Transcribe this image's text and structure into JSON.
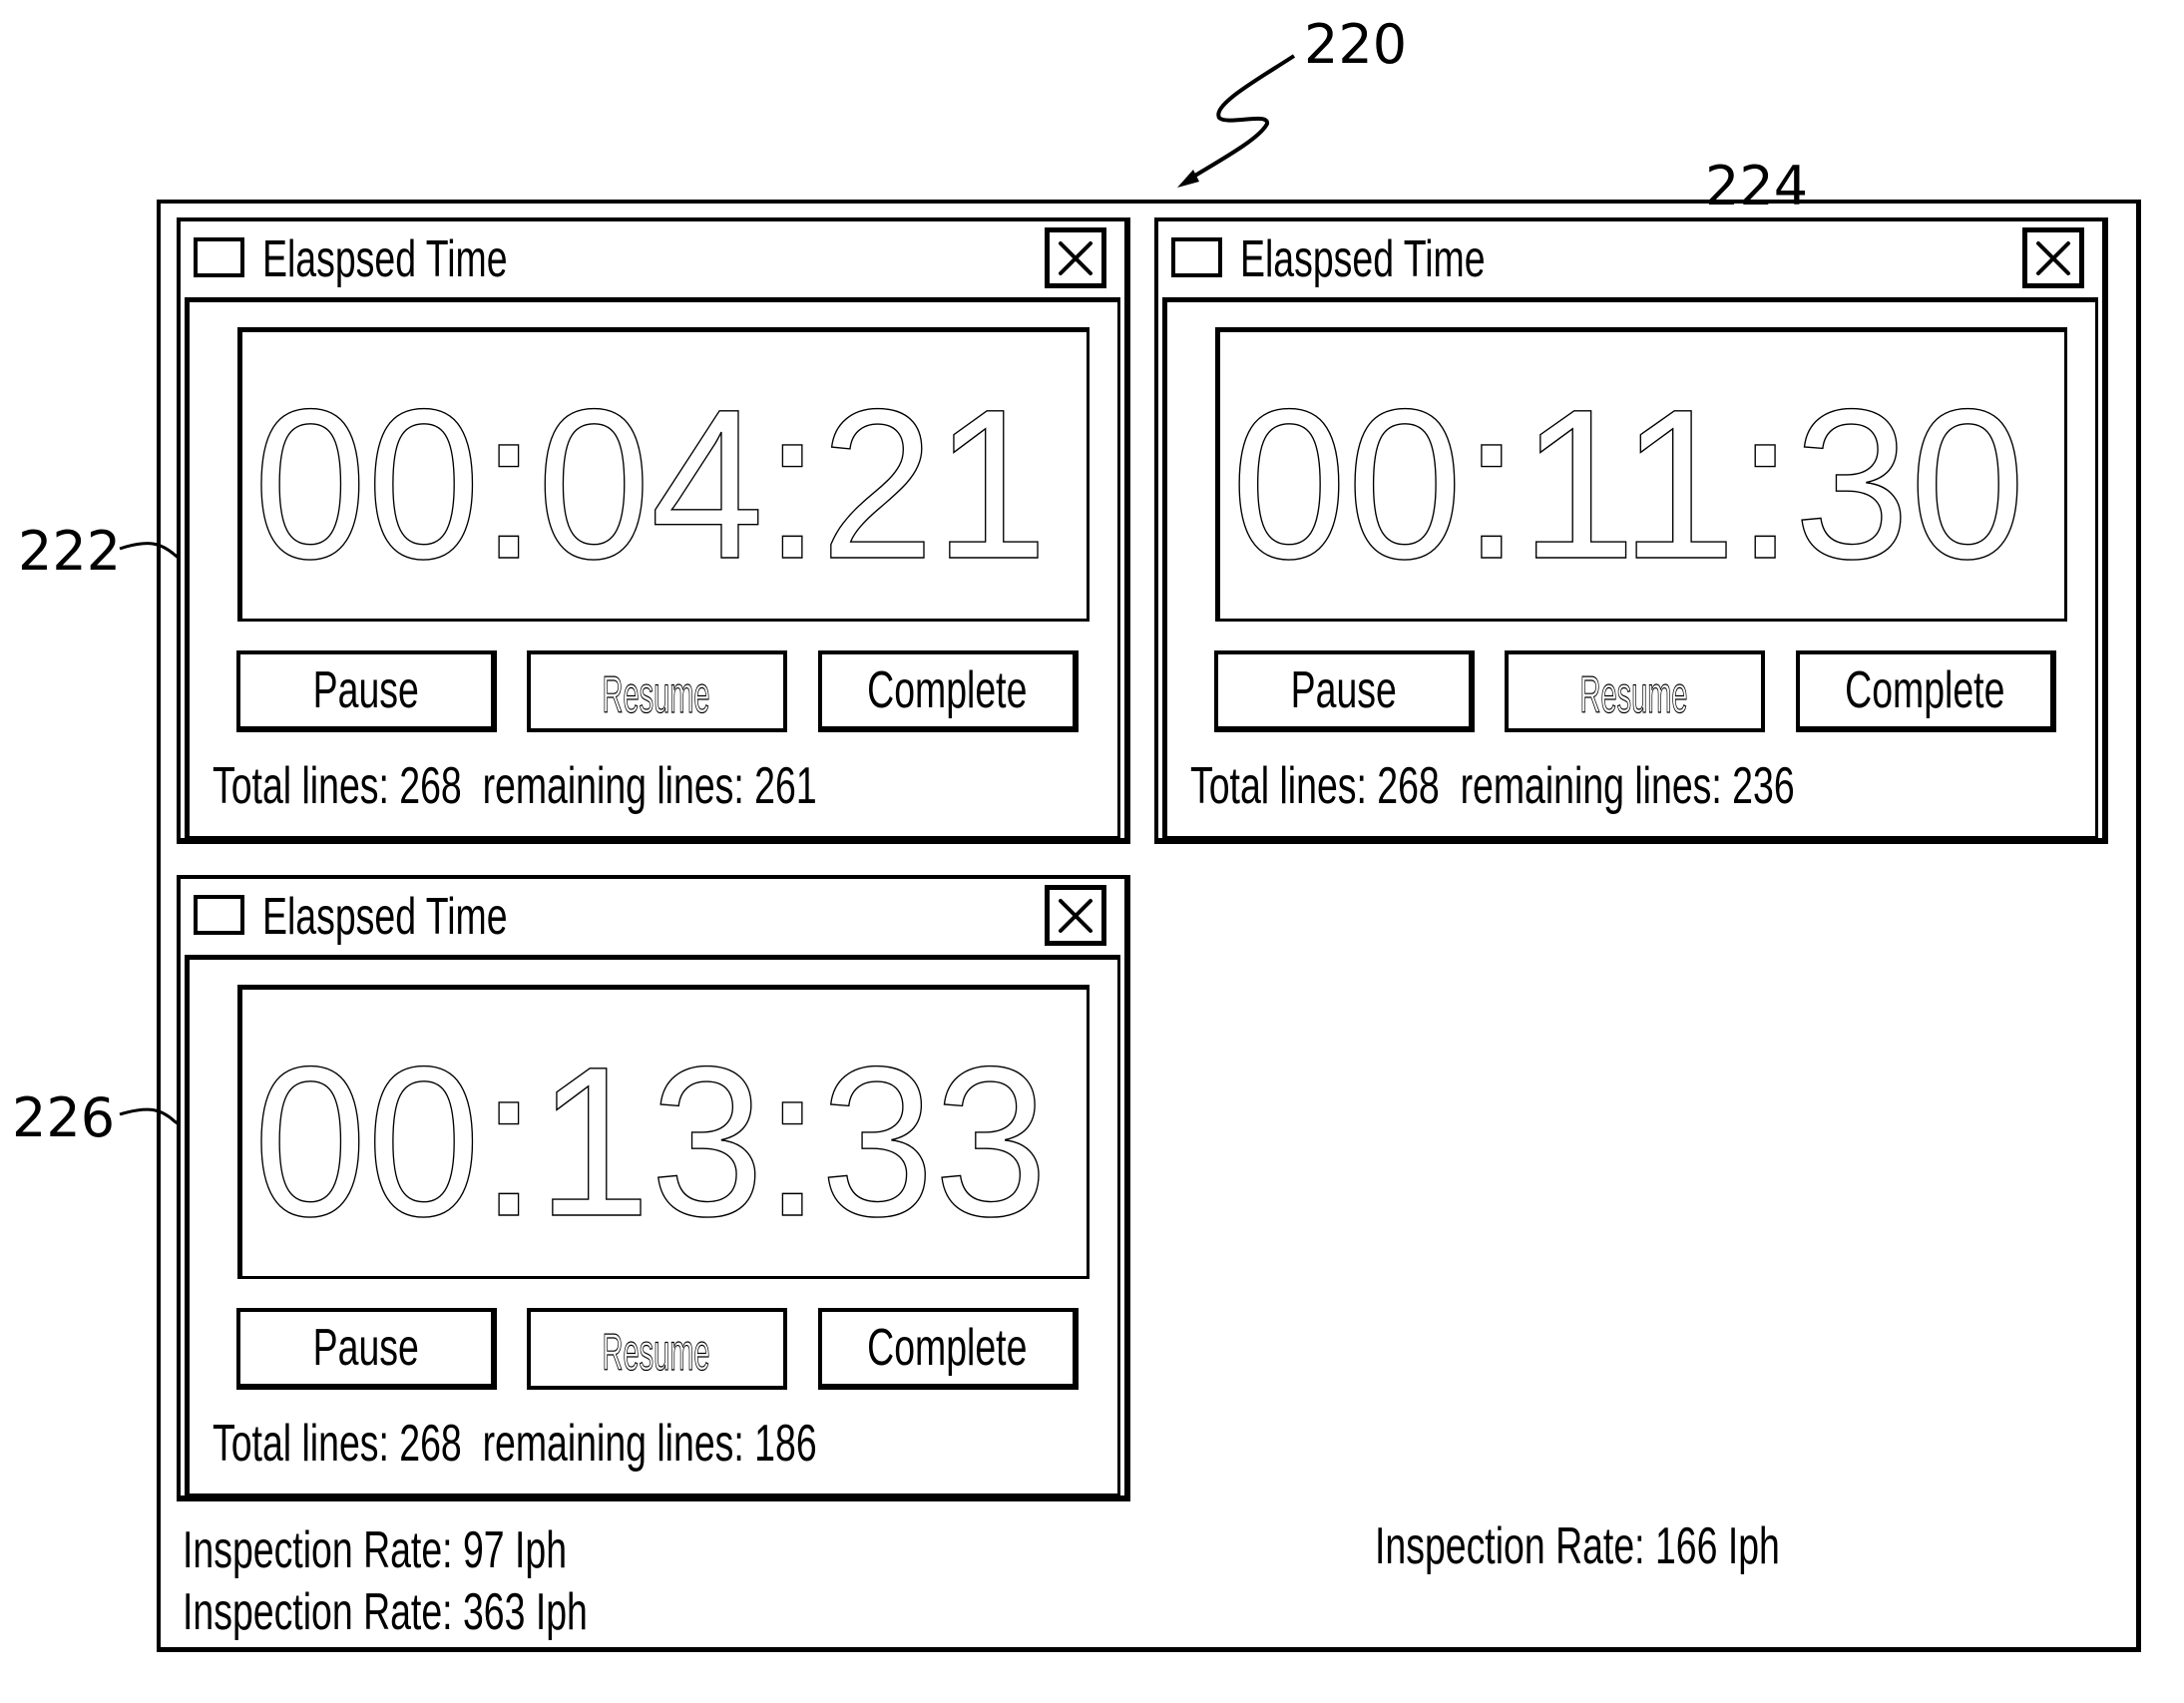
{
  "figure": {
    "ref_labels": {
      "main": "220",
      "window_1": "222",
      "window_2": "224",
      "window_3": "226"
    }
  },
  "windows": [
    {
      "title": "Elaspsed Time",
      "timer": "00:04:21",
      "buttons": {
        "pause": "Pause",
        "resume": "Resume",
        "complete": "Complete"
      },
      "resume_enabled": false,
      "status": "Total lines: 268  remaining lines: 261",
      "total_lines": 268,
      "remaining_lines": 261
    },
    {
      "title": "Elaspsed Time",
      "timer": "00:11:30",
      "buttons": {
        "pause": "Pause",
        "resume": "Resume",
        "complete": "Complete"
      },
      "resume_enabled": false,
      "status": "Total lines: 268  remaining lines: 236",
      "total_lines": 268,
      "remaining_lines": 236
    },
    {
      "title": "Elaspsed Time",
      "timer": "00:13:33",
      "buttons": {
        "pause": "Pause",
        "resume": "Resume",
        "complete": "Complete"
      },
      "resume_enabled": false,
      "status": "Total lines: 268  remaining lines: 186",
      "total_lines": 268,
      "remaining_lines": 186
    }
  ],
  "inspection_rates": {
    "left": [
      "Inspection Rate: 97 Iph",
      "Inspection Rate: 363 Iph"
    ],
    "right": "Inspection Rate: 166 Iph"
  },
  "icons": {
    "close": "close-x-icon",
    "window_checkbox": "checkbox-icon"
  },
  "colors": {
    "line": "#000000",
    "background": "#ffffff"
  }
}
